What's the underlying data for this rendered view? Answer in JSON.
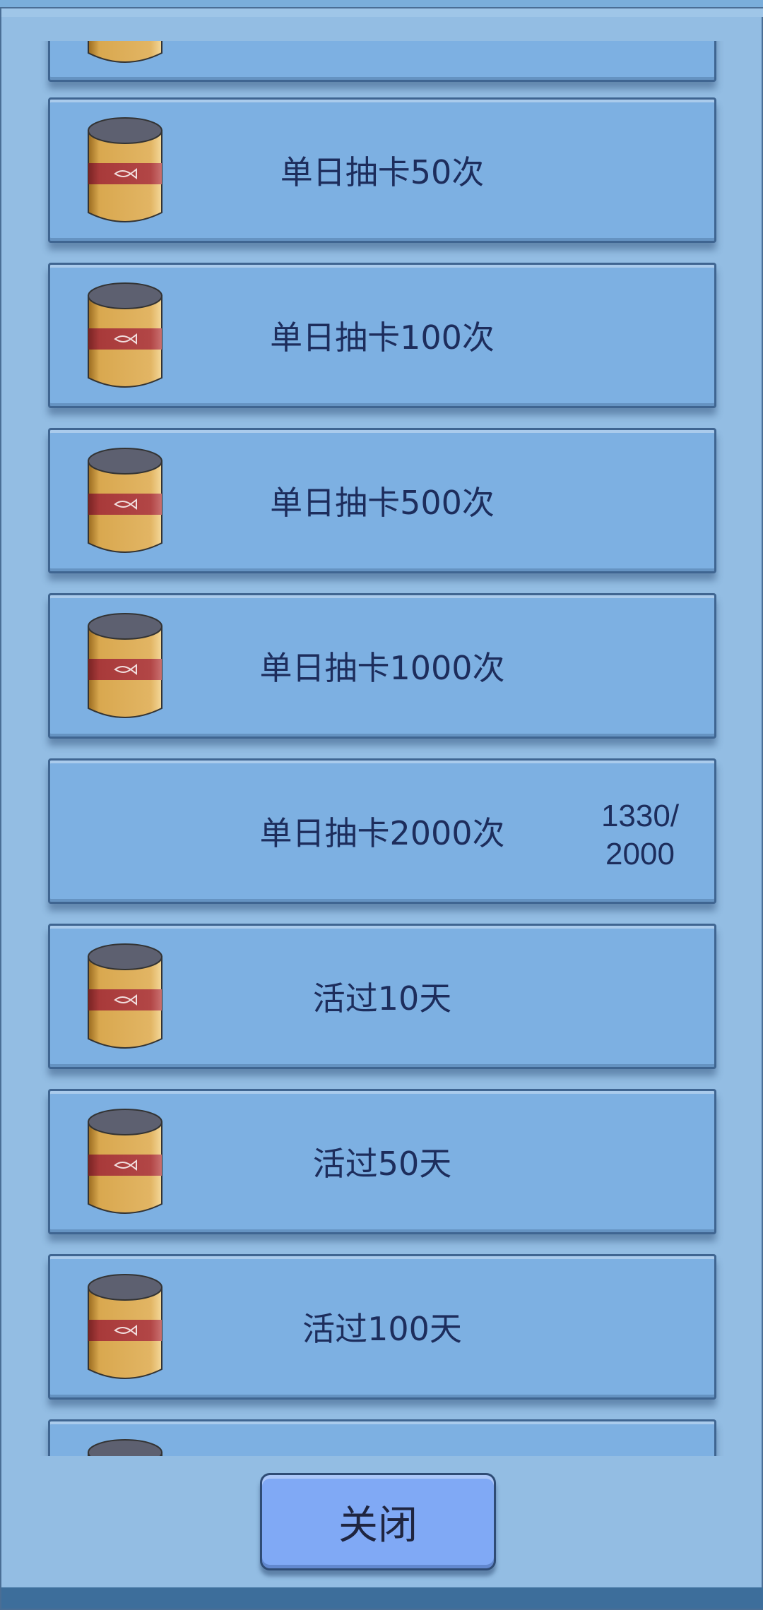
{
  "items": [
    {
      "label": "单日抽卡50次",
      "icon": "fish-can-icon",
      "has_icon": true
    },
    {
      "label": "单日抽卡100次",
      "icon": "fish-can-icon",
      "has_icon": true
    },
    {
      "label": "单日抽卡500次",
      "icon": "fish-can-icon",
      "has_icon": true
    },
    {
      "label": "单日抽卡1000次",
      "icon": "fish-can-icon",
      "has_icon": true
    },
    {
      "label": "单日抽卡2000次",
      "has_icon": false,
      "progress_line1": "1330/",
      "progress_line2": "2000"
    },
    {
      "label": "活过10天",
      "icon": "fish-can-icon",
      "has_icon": true
    },
    {
      "label": "活过50天",
      "icon": "fish-can-icon",
      "has_icon": true
    },
    {
      "label": "活过100天",
      "icon": "fish-can-icon",
      "has_icon": true
    }
  ],
  "close_button": {
    "label": "关闭"
  },
  "colors": {
    "panel": "#93bde3",
    "item_bg": "#7db0e2",
    "item_border": "#3f6591",
    "text": "#1d2d5c",
    "button": "#80a9f5",
    "can_gold": "#d9a84f",
    "can_red": "#a83a3a",
    "can_top": "#5d6070"
  }
}
